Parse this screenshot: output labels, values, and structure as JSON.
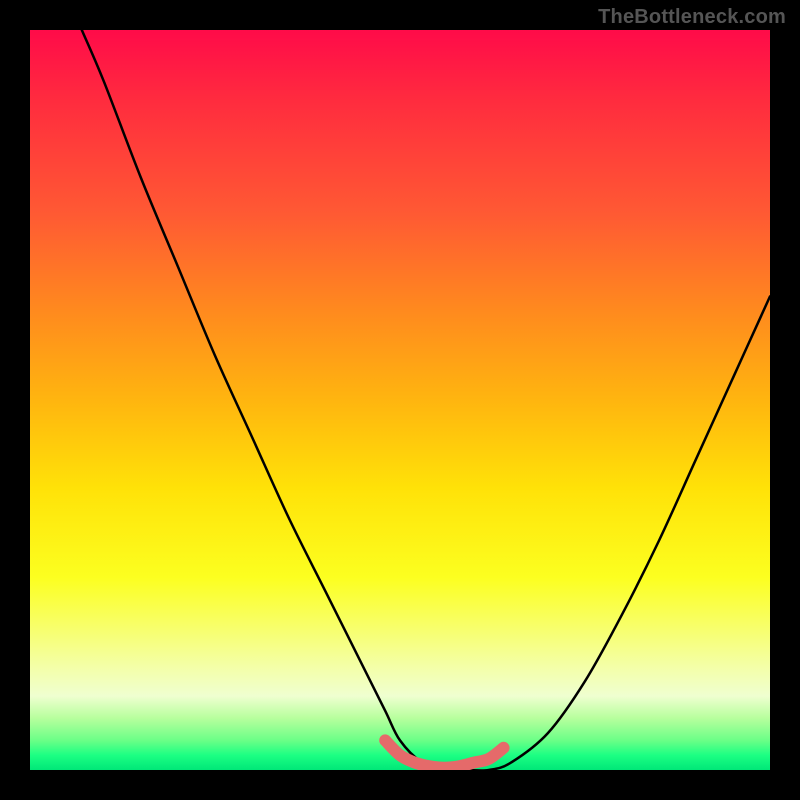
{
  "watermark": "TheBottleneck.com",
  "chart_data": {
    "type": "line",
    "title": "",
    "xlabel": "",
    "ylabel": "",
    "xlim": [
      0,
      100
    ],
    "ylim": [
      0,
      100
    ],
    "series": [
      {
        "name": "bottleneck-curve",
        "x": [
          7,
          10,
          15,
          20,
          25,
          30,
          35,
          40,
          45,
          48,
          50,
          53,
          56,
          59,
          62,
          65,
          70,
          75,
          80,
          85,
          90,
          95,
          100
        ],
        "values": [
          100,
          93,
          80,
          68,
          56,
          45,
          34,
          24,
          14,
          8,
          4,
          1,
          0,
          0,
          0,
          1,
          5,
          12,
          21,
          31,
          42,
          53,
          64
        ]
      },
      {
        "name": "optimal-zone",
        "x": [
          48,
          50,
          52,
          54,
          56,
          58,
          60,
          62,
          64
        ],
        "values": [
          4,
          2,
          1,
          0.5,
          0.3,
          0.5,
          1,
          1.5,
          3
        ]
      }
    ],
    "gradient_stops": [
      {
        "pos": 0,
        "color": "#ff0b49"
      },
      {
        "pos": 10,
        "color": "#ff2d3e"
      },
      {
        "pos": 25,
        "color": "#ff5a33"
      },
      {
        "pos": 38,
        "color": "#ff8a1e"
      },
      {
        "pos": 50,
        "color": "#ffb50f"
      },
      {
        "pos": 62,
        "color": "#ffe208"
      },
      {
        "pos": 74,
        "color": "#fcff20"
      },
      {
        "pos": 81,
        "color": "#f7ff6e"
      },
      {
        "pos": 86,
        "color": "#f4ffa7"
      },
      {
        "pos": 90,
        "color": "#efffd0"
      },
      {
        "pos": 93,
        "color": "#b7ff9d"
      },
      {
        "pos": 96,
        "color": "#6bff87"
      },
      {
        "pos": 98,
        "color": "#1cff83"
      },
      {
        "pos": 100,
        "color": "#00e778"
      }
    ],
    "colors": {
      "curve": "#000000",
      "highlight": "#e56a6a",
      "frame": "#000000"
    }
  }
}
